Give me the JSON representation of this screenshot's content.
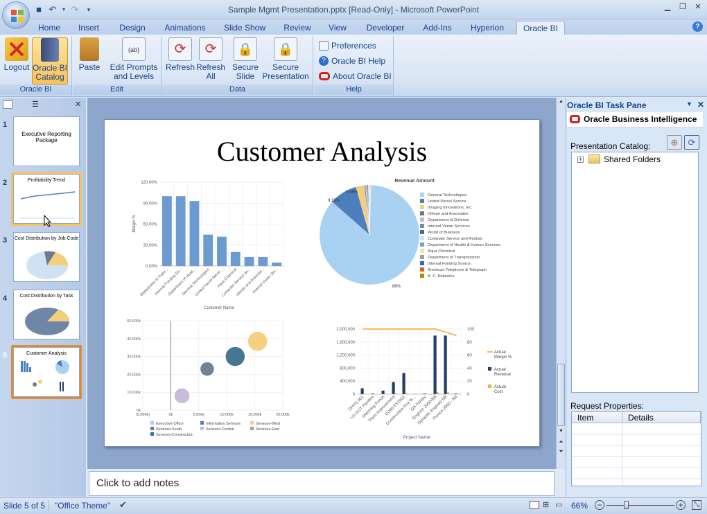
{
  "window": {
    "title": "Sample Mgmt Presentation.pptx [Read-Only] - Microsoft PowerPoint"
  },
  "tabs": [
    "Home",
    "Insert",
    "Design",
    "Animations",
    "Slide Show",
    "Review",
    "View",
    "Developer",
    "Add-Ins",
    "Hyperion",
    "Oracle BI"
  ],
  "active_tab": "Oracle BI",
  "ribbon": {
    "groups": {
      "oraclebi": "Oracle BI",
      "edit": "Edit",
      "data": "Data",
      "help": "Help"
    },
    "logout": "Logout",
    "catalog_1": "Oracle BI",
    "catalog_2": "Catalog",
    "paste": "Paste",
    "edit_prompts_1": "Edit Prompts",
    "edit_prompts_2": "and Levels",
    "refresh": "Refresh",
    "refresh_all_1": "Refresh",
    "refresh_all_2": "All",
    "secure_slide_1": "Secure",
    "secure_slide_2": "Slide",
    "secure_pres_1": "Secure",
    "secure_pres_2": "Presentation",
    "preferences": "Preferences",
    "bi_help": "Oracle BI Help",
    "about": "About Oracle BI"
  },
  "slides": [
    {
      "num": "1",
      "title": "Executive Reporting Package"
    },
    {
      "num": "2",
      "title": "Profitability Trend"
    },
    {
      "num": "3",
      "title": "Cost Distribution by Job Code"
    },
    {
      "num": "4",
      "title": "Cost Distribution by Task"
    },
    {
      "num": "5",
      "title": "Customer Analysis"
    }
  ],
  "slide": {
    "title": "Customer Analysis"
  },
  "notes": {
    "placeholder": "Click to add notes"
  },
  "taskpane": {
    "title": "Oracle BI Task Pane",
    "header": "Oracle Business Intelligence",
    "catalog_label": "Presentation Catalog:",
    "folder": "Shared Folders",
    "req_label": "Request Properties:",
    "col_item": "Item",
    "col_details": "Details"
  },
  "status": {
    "slide": "Slide 5 of 5",
    "theme": "\"Office Theme\"",
    "zoom": "66%"
  },
  "chart_data": [
    {
      "type": "bar",
      "xlabel": "Customer Name",
      "ylabel": "Margin %",
      "ylim": [
        0,
        120
      ],
      "yticks": [
        "120.00%",
        "90.00%",
        "60.00%",
        "30.00%",
        "0.00%"
      ],
      "categories": [
        "Department of Trans...",
        "Internal Funding So...",
        "Department of Healt...",
        "General Technologies",
        "United Parcel Servic...",
        "Aqua Chemical",
        "Computer Service an...",
        "Hilman and Associat...",
        "Internal-Vision Ser..."
      ],
      "values": [
        100,
        100,
        93,
        45,
        42,
        20,
        13,
        13,
        5
      ]
    },
    {
      "type": "pie",
      "title": "Revenue Amount",
      "labels": [
        "General Technologies",
        "United Parcel Service",
        "Imaging Innovations, Inc.",
        "Hilman and Associates",
        "Department of Defense",
        "Internal-Vision Services",
        "World of Business",
        "Computer Service and Rentals",
        "Department of Health & Human Services",
        "Aqua Chemical",
        "Department of Transportation",
        "Internal Funding Source",
        "American Telephone & Telegraph",
        "A. C. Networks"
      ],
      "values": [
        86,
        9.19,
        2.68,
        0.4,
        0.3,
        0.3,
        0.25,
        0.2,
        0.2,
        0.15,
        0.1,
        0.1,
        0.08,
        0.05
      ],
      "colors": [
        "#a9d2f2",
        "#4c7fbe",
        "#f4cf7a",
        "#6b7c8f",
        "#c7b8d9",
        "#7a8aa0",
        "#3e6f8f",
        "#cfe2f3",
        "#7aa2cc",
        "#f7e9a0",
        "#a0a0a0",
        "#3a66c4",
        "#d2691e",
        "#b8860b"
      ],
      "data_labels": [
        "86%",
        "9.19%",
        "2.68%"
      ]
    },
    {
      "type": "scatter",
      "subtype": "bubble",
      "xlim": [
        -5000,
        20000
      ],
      "ylim": [
        0,
        50000
      ],
      "xticks": [
        "(5,000k)",
        "0k",
        "5,000k",
        "10,000k",
        "15,000k",
        "20,000k"
      ],
      "yticks": [
        "50,000k",
        "40,000k",
        "30,000k",
        "20,000k",
        "10,000k",
        "0k"
      ],
      "series": [
        {
          "name": "Executive Office",
          "color": "#a9d2f2",
          "x": 0,
          "y": 0,
          "size": 0
        },
        {
          "name": "Information Services",
          "color": "#4c7fbe",
          "x": 0,
          "y": 0,
          "size": 0
        },
        {
          "name": "Services-West",
          "color": "#f4cf7a",
          "x": 15500,
          "y": 38500,
          "size": 14
        },
        {
          "name": "Services-South",
          "color": "#6b7c8f",
          "x": 6500,
          "y": 23000,
          "size": 10
        },
        {
          "name": "Services-Central",
          "color": "#c7b8d9",
          "x": 2000,
          "y": 8000,
          "size": 11
        },
        {
          "name": "Services-East",
          "color": "#a0a0a0",
          "x": 0,
          "y": 0,
          "size": 0
        },
        {
          "name": "Services-Construction",
          "color": "#3e6f8f",
          "x": 11500,
          "y": 30000,
          "size": 14
        }
      ]
    },
    {
      "type": "bar",
      "subtype": "combo",
      "xlabel": "Project Name",
      "ylim": [
        0,
        2000000
      ],
      "y2lim": [
        0,
        100
      ],
      "yticks": [
        "2,000,000",
        "1,600,000",
        "1,200,000",
        "800,000",
        "400,000",
        "0"
      ],
      "y2ticks": [
        "100",
        "80",
        "60",
        "40",
        "20",
        "0"
      ],
      "categories": [
        "DHHS 001",
        "US DOT Pipeline",
        "Matching Funds",
        "Trans Improvement",
        "CD80-FY2002",
        "Construction Proj %...",
        "QA-Yardsy",
        "Engines 2000-Bill",
        "Dynamic Engines-Bill",
        "Pumps 2000 - Bill"
      ],
      "series": [
        {
          "name": "Actual Revenue",
          "color": "#1f3f66",
          "values": [
            180000,
            20000,
            110000,
            370000,
            650000,
            10000,
            20000,
            1800000,
            1800000,
            20000
          ]
        },
        {
          "name": "Actual Cost",
          "color": "#e8b84f",
          "values": [
            10000,
            5000,
            10000,
            20000,
            30000,
            5000,
            10000,
            60000,
            60000,
            10000
          ]
        },
        {
          "name": "Actual Margin %",
          "color": "#f3a12b",
          "values": [
            100,
            100,
            100,
            100,
            100,
            100,
            100,
            100,
            95,
            90
          ]
        }
      ]
    }
  ]
}
